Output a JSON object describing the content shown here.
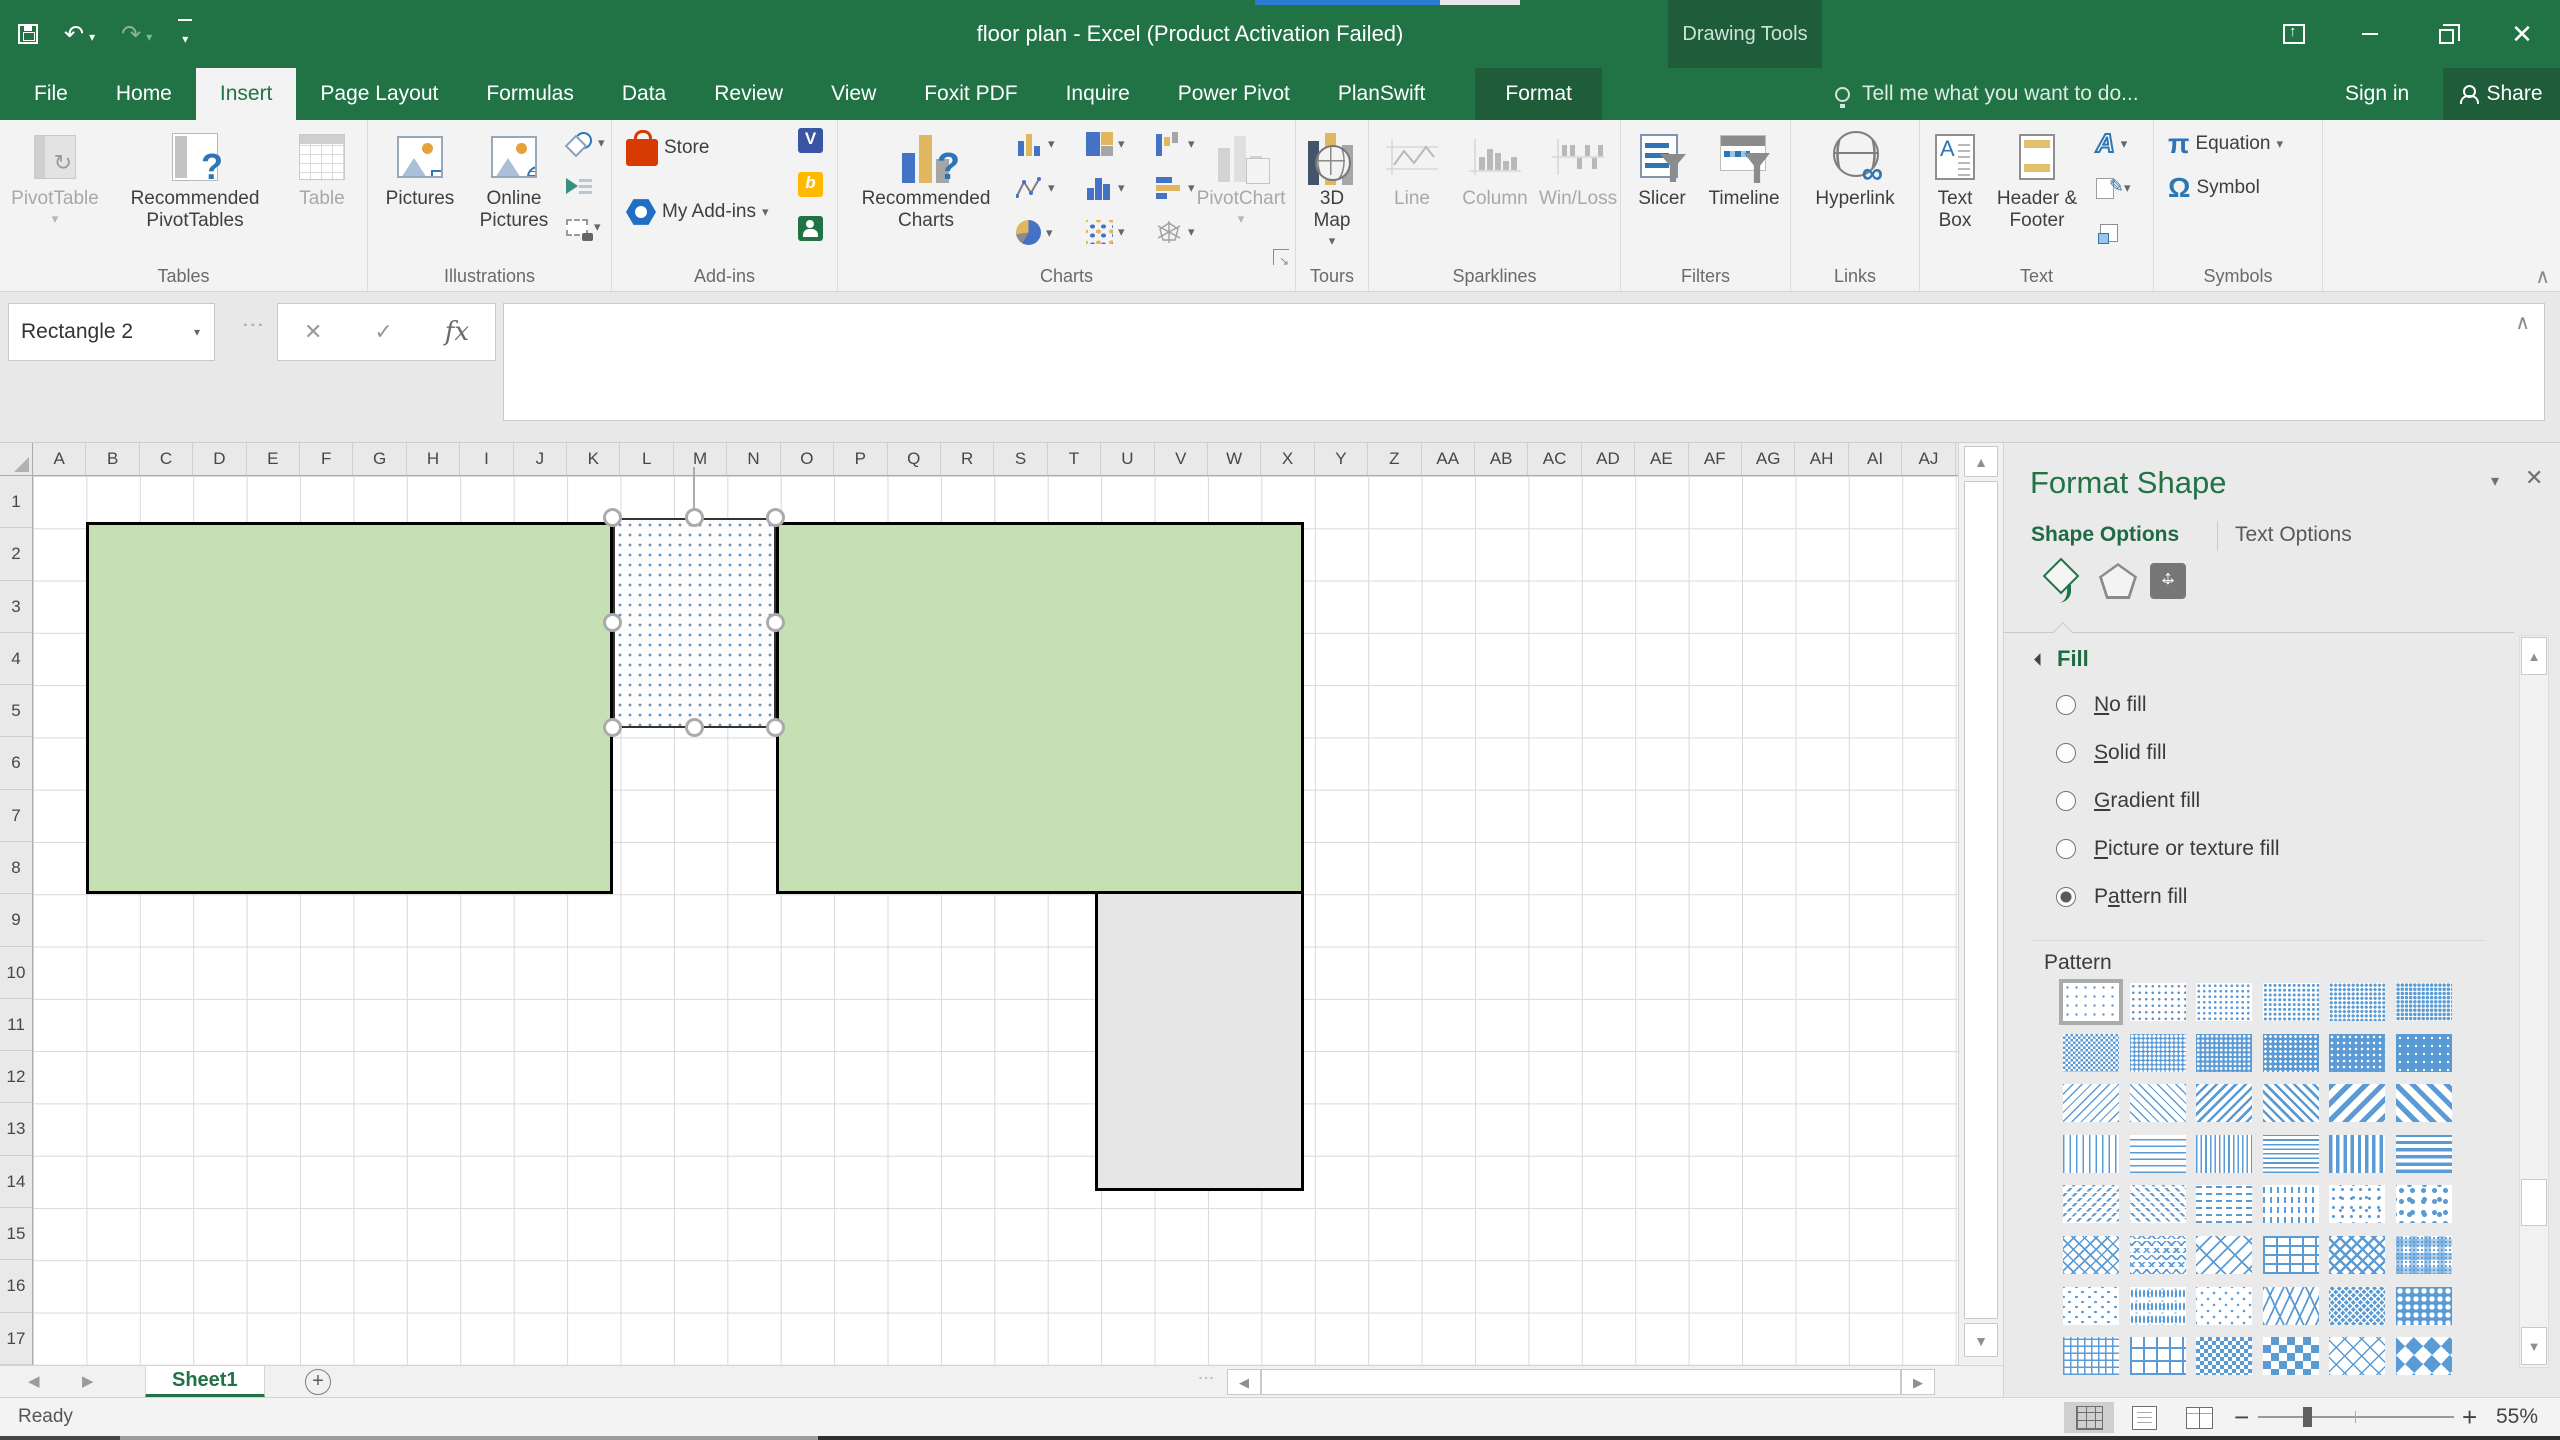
{
  "titlebar": {
    "title": "floor plan - Excel (Product Activation Failed)",
    "contextual_label": "Drawing Tools",
    "quick_access": {
      "save": "Save",
      "undo": "Undo",
      "redo": "Redo",
      "customize": "Customize Quick Access Toolbar"
    },
    "window_controls": {
      "ribbon_display": "Ribbon Display Options",
      "minimize": "Minimize",
      "restore": "Restore Down",
      "close": "Close"
    }
  },
  "tabs": [
    {
      "label": "File",
      "file": true
    },
    {
      "label": "Home"
    },
    {
      "label": "Insert",
      "active": true
    },
    {
      "label": "Page Layout"
    },
    {
      "label": "Formulas"
    },
    {
      "label": "Data"
    },
    {
      "label": "Review"
    },
    {
      "label": "View"
    },
    {
      "label": "Foxit PDF"
    },
    {
      "label": "Inquire"
    },
    {
      "label": "Power Pivot"
    },
    {
      "label": "PlanSwift"
    },
    {
      "label": "Format",
      "contextual": true
    }
  ],
  "tellme": {
    "text": "Tell me what you want to do..."
  },
  "account": {
    "sign_in": "Sign in",
    "share": "Share"
  },
  "ribbon": {
    "tables": {
      "group": "Tables",
      "pivottable": "PivotTable",
      "recommended": "Recommended PivotTables",
      "table": "Table"
    },
    "illustrations": {
      "group": "Illustrations",
      "pictures": "Pictures",
      "online": "Online Pictures"
    },
    "addins": {
      "group": "Add-ins",
      "store": "Store",
      "my_addins": "My Add-ins"
    },
    "charts": {
      "group": "Charts",
      "recommended": "Recommended Charts",
      "pivotchart": "PivotChart"
    },
    "tours": {
      "group": "Tours",
      "map3d": "3D Map"
    },
    "sparklines": {
      "group": "Sparklines",
      "line": "Line",
      "column": "Column",
      "winloss": "Win/Loss"
    },
    "filters": {
      "group": "Filters",
      "slicer": "Slicer",
      "timeline": "Timeline"
    },
    "links": {
      "group": "Links",
      "hyperlink": "Hyperlink"
    },
    "text": {
      "group": "Text",
      "textbox": "Text Box",
      "headerfooter": "Header & Footer"
    },
    "symbols": {
      "group": "Symbols",
      "equation": "Equation",
      "symbol": "Symbol"
    }
  },
  "formula_bar": {
    "name_box": "Rectangle 2"
  },
  "grid": {
    "columns": [
      "A",
      "B",
      "C",
      "D",
      "E",
      "F",
      "G",
      "H",
      "I",
      "J",
      "K",
      "L",
      "M",
      "N",
      "O",
      "P",
      "Q",
      "R",
      "S",
      "T",
      "U",
      "V",
      "W",
      "X",
      "Y",
      "Z",
      "AA",
      "AB",
      "AC",
      "AD",
      "AE",
      "AF",
      "AG",
      "AH",
      "AI",
      "AJ"
    ],
    "rows": [
      "1",
      "2",
      "3",
      "4",
      "5",
      "6",
      "7",
      "8",
      "9",
      "10",
      "11",
      "12",
      "13",
      "14",
      "15",
      "16",
      "17"
    ]
  },
  "canvas_shapes": {
    "room_fill": "#c6e0b4",
    "outline_color": "#000000",
    "annex_fill": "#e7e6e6",
    "selected_shape_name": "Rectangle 2",
    "selected_shape_fill": "Pattern fill 5%"
  },
  "format_pane": {
    "title": "Format Shape",
    "tab_shape": "Shape Options",
    "tab_text": "Text Options",
    "section_fill": "Fill",
    "fill_options": [
      {
        "label": "No fill",
        "key": 0
      },
      {
        "label": "Solid fill",
        "key": 0
      },
      {
        "label": "Gradient fill",
        "key": 0
      },
      {
        "label": "Picture or texture fill",
        "key": 0
      },
      {
        "label": "Pattern fill",
        "key": 1,
        "selected": true
      }
    ],
    "pattern_label": "Pattern",
    "selected_pattern": "5%",
    "pattern_color": "#5b9bd5",
    "patterns": [
      "5%",
      "10%",
      "20%",
      "25%",
      "30%",
      "40%",
      "50%",
      "60%",
      "70%",
      "75%",
      "80%",
      "90%",
      "Light downward diagonal",
      "Light upward diagonal",
      "Dark downward diagonal",
      "Dark upward diagonal",
      "Wide downward diagonal",
      "Wide upward diagonal",
      "Light vertical",
      "Light horizontal",
      "Narrow vertical",
      "Narrow horizontal",
      "Dark vertical",
      "Dark horizontal",
      "Dashed downward diagonal",
      "Dashed upward diagonal",
      "Dashed horizontal",
      "Dashed vertical",
      "Small confetti",
      "Large confetti",
      "Zigzag",
      "Wave",
      "Diagonal brick",
      "Horizontal brick",
      "Weave",
      "Plaid",
      "Divot",
      "Dotted grid",
      "Dotted diamond",
      "Shingle",
      "Trellis",
      "Sphere",
      "Small grid",
      "Large grid",
      "Small checker board",
      "Large checker board",
      "Outlined diamond",
      "Solid diamond"
    ]
  },
  "sheet_bar": {
    "active_sheet": "Sheet1",
    "add_sheet": "New sheet"
  },
  "status_bar": {
    "status": "Ready",
    "zoom_level": "55%"
  }
}
